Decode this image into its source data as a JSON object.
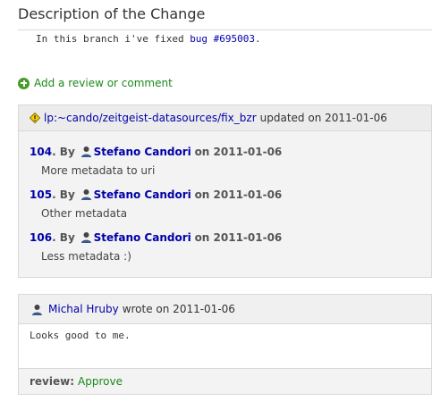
{
  "description": {
    "title": "Description of the Change",
    "text_prefix": "In this branch i've fixed ",
    "bug_link": "bug #695003",
    "text_suffix": "."
  },
  "add_review": {
    "label": "Add a review or comment"
  },
  "branch_update": {
    "branch": "lp:~cando/zeitgeist-datasources/fix_bzr",
    "updated_text": "updated on 2011-01-06",
    "revisions": [
      {
        "number": "104",
        "by": ". By",
        "author": "Stefano Candori",
        "date": "on 2011-01-06",
        "message": "More metadata to uri"
      },
      {
        "number": "105",
        "by": ". By",
        "author": "Stefano Candori",
        "date": "on 2011-01-06",
        "message": "Other metadata"
      },
      {
        "number": "106",
        "by": ". By",
        "author": "Stefano Candori",
        "date": "on 2011-01-06",
        "message": "Less metadata :)"
      }
    ]
  },
  "comment": {
    "author": "Michal Hruby",
    "wrote_text": "wrote on 2011-01-06",
    "body": "Looks good to me.",
    "review_label": "review:",
    "review_value": "Approve"
  },
  "icons": {
    "add": "add-icon",
    "branch": "warning-diamond-icon",
    "person": "person-icon"
  },
  "colors": {
    "link": "#0000aa",
    "approve": "#1a8a1a"
  }
}
